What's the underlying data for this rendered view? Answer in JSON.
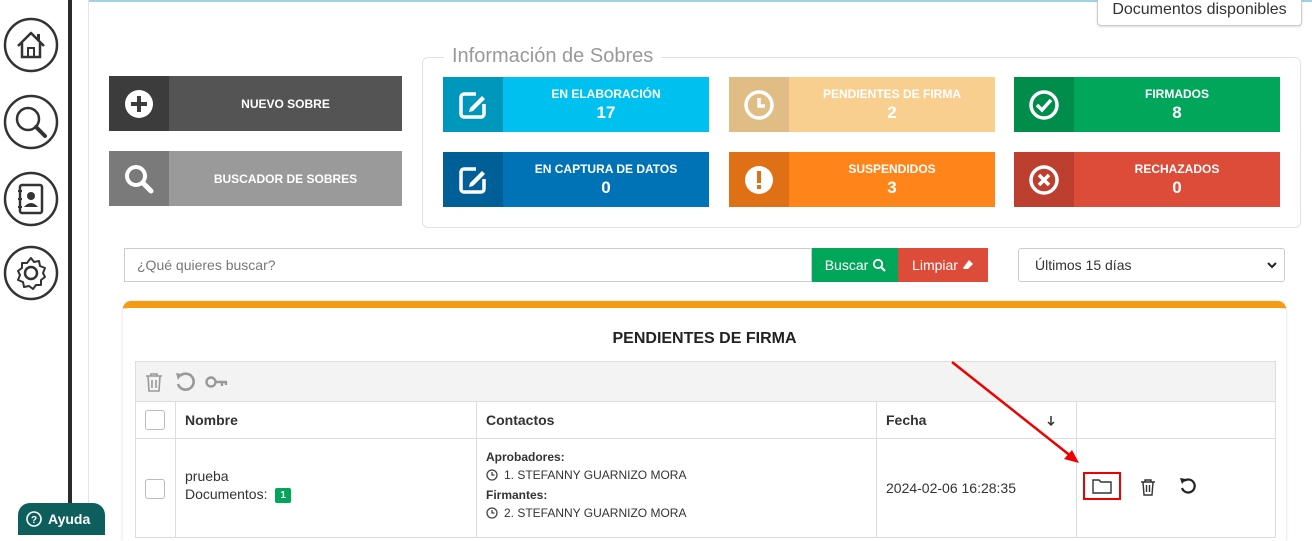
{
  "top": {
    "docs_button": "Documentos disponibles"
  },
  "sidebar": {
    "items": [
      {
        "name": "home-icon"
      },
      {
        "name": "search-icon"
      },
      {
        "name": "contacts-icon"
      },
      {
        "name": "gear-icon"
      }
    ],
    "help_label": "Ayuda"
  },
  "actions": {
    "new_label": "NUEVO SOBRE",
    "search_label": "BUSCADOR DE SOBRES"
  },
  "info": {
    "legend": "Información de Sobres",
    "tiles": [
      {
        "title": "EN ELABORACIÓN",
        "value": "17",
        "color": "#00c0ef",
        "dark": "#0097bc",
        "icon": "edit-icon"
      },
      {
        "title": "PENDIENTES DE FIRMA",
        "value": "2",
        "color": "#f8cf8f",
        "dark": "#e0bd84",
        "icon": "clock-icon"
      },
      {
        "title": "FIRMADOS",
        "value": "8",
        "color": "#00a65a",
        "dark": "#008d4c",
        "icon": "check-circle-icon"
      },
      {
        "title": "EN CAPTURA DE DATOS",
        "value": "0",
        "color": "#0073b7",
        "dark": "#005f97",
        "icon": "edit-icon"
      },
      {
        "title": "SUSPENDIDOS",
        "value": "3",
        "color": "#ff851b",
        "dark": "#e07016",
        "icon": "exclamation-icon"
      },
      {
        "title": "RECHAZADOS",
        "value": "0",
        "color": "#dd4b39",
        "dark": "#bc3f30",
        "icon": "x-circle-icon"
      }
    ]
  },
  "search": {
    "placeholder": "¿Qué quieres buscar?",
    "buscar_label": "Buscar",
    "limpiar_label": "Limpiar",
    "range_value": "Últimos 15 días"
  },
  "table": {
    "title": "PENDIENTES DE FIRMA",
    "columns": [
      "Nombre",
      "Contactos",
      "Fecha"
    ],
    "rows": [
      {
        "nombre": "prueba",
        "documentos_label": "Documentos:",
        "documentos_count": "1",
        "aprobadores_label": "Aprobadores:",
        "aprobador": "1. STEFANNY GUARNIZO MORA",
        "firmantes_label": "Firmantes:",
        "firmante": "2. STEFANNY GUARNIZO MORA",
        "fecha": "2024-02-06 16:28:35"
      }
    ]
  }
}
